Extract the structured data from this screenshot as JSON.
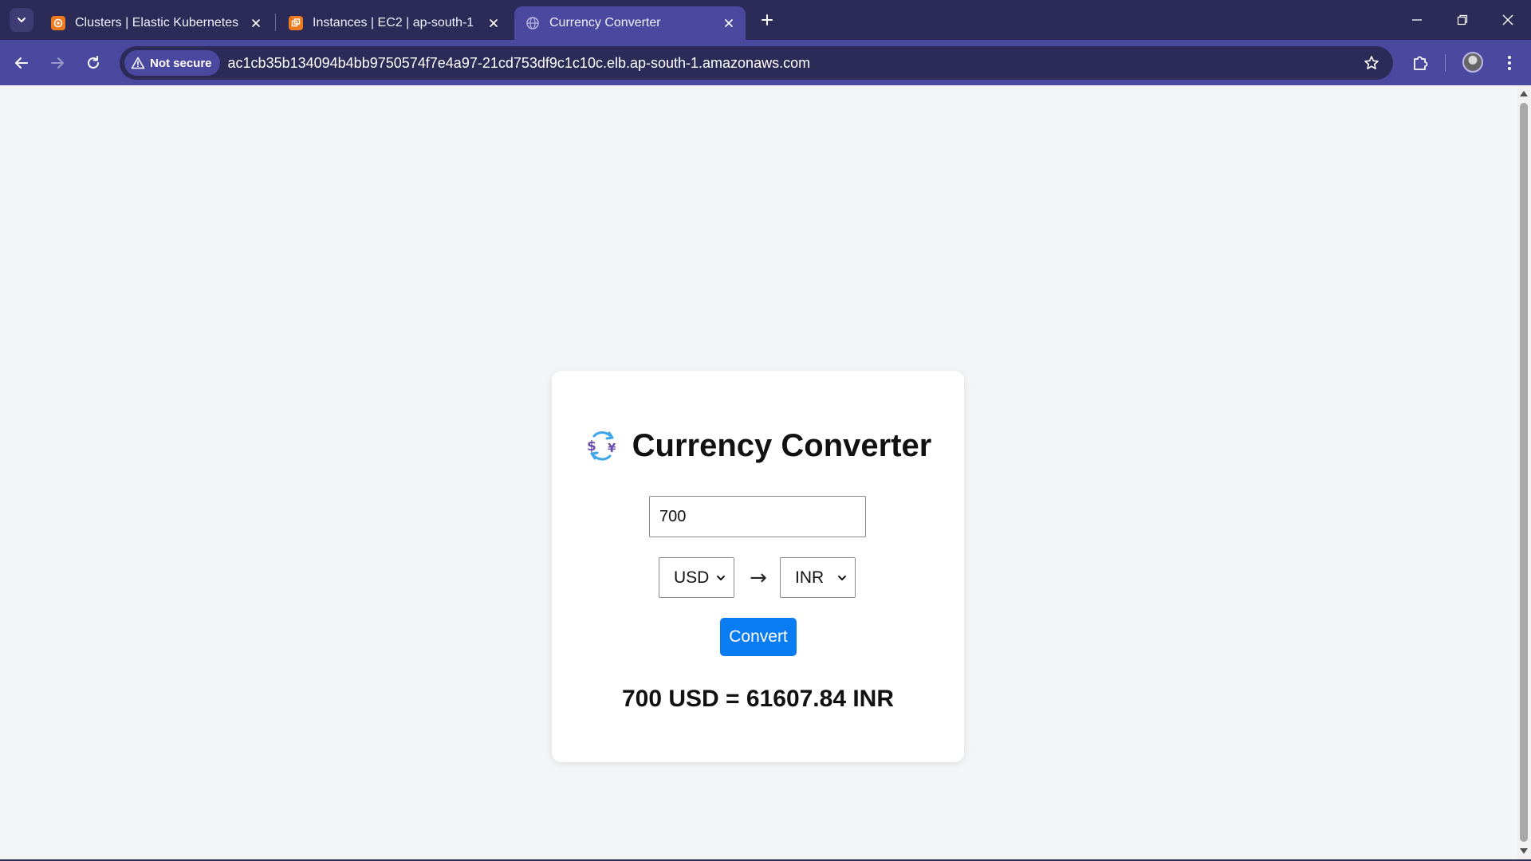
{
  "browser": {
    "tabs": [
      {
        "title": "Clusters | Elastic Kubernetes Service",
        "icon": "aws-eks-icon",
        "active": false
      },
      {
        "title": "Instances | EC2 | ap-south-1",
        "icon": "aws-ec2-icon",
        "active": false
      },
      {
        "title": "Currency Converter",
        "icon": "globe-icon",
        "active": true
      }
    ],
    "security_label": "Not secure",
    "url": "ac1cb35b134094b4bb9750574f7e4a97-21cd753df9c1c10c.elb.ap-south-1.amazonaws.com",
    "colors": {
      "tabstrip": "#2c2a56",
      "toolbar": "#4b48a0"
    }
  },
  "app": {
    "title": "Currency Converter",
    "title_icon": "currency-exchange-icon",
    "amount_value": "700",
    "from_currency": "USD",
    "to_currency": "INR",
    "arrow": "→",
    "convert_label": "Convert",
    "result_text": "700 USD = 61607.84 INR",
    "colors": {
      "button": "#0a7cf2",
      "card": "#ffffff",
      "background": "#f4f5f7"
    }
  }
}
